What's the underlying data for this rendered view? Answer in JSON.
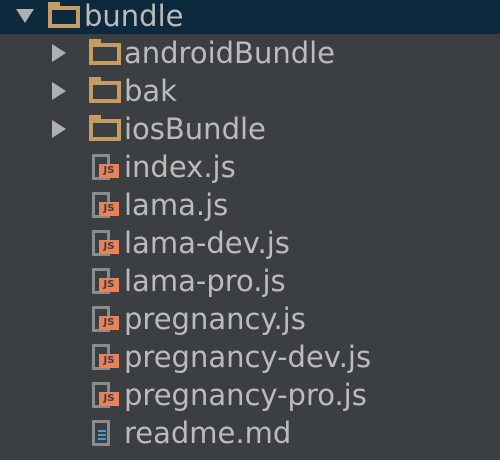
{
  "tree": {
    "root": {
      "label": "bundle",
      "expanded": true
    },
    "folders": [
      {
        "label": "androidBundle"
      },
      {
        "label": "bak"
      },
      {
        "label": "iosBundle"
      }
    ],
    "files": [
      {
        "label": "index.js",
        "type": "js"
      },
      {
        "label": "lama.js",
        "type": "js"
      },
      {
        "label": "lama-dev.js",
        "type": "js"
      },
      {
        "label": "lama-pro.js",
        "type": "js"
      },
      {
        "label": "pregnancy.js",
        "type": "js"
      },
      {
        "label": "pregnancy-dev.js",
        "type": "js"
      },
      {
        "label": "pregnancy-pro.js",
        "type": "js"
      },
      {
        "label": "readme.md",
        "type": "md"
      }
    ],
    "js_badge": "JS"
  }
}
